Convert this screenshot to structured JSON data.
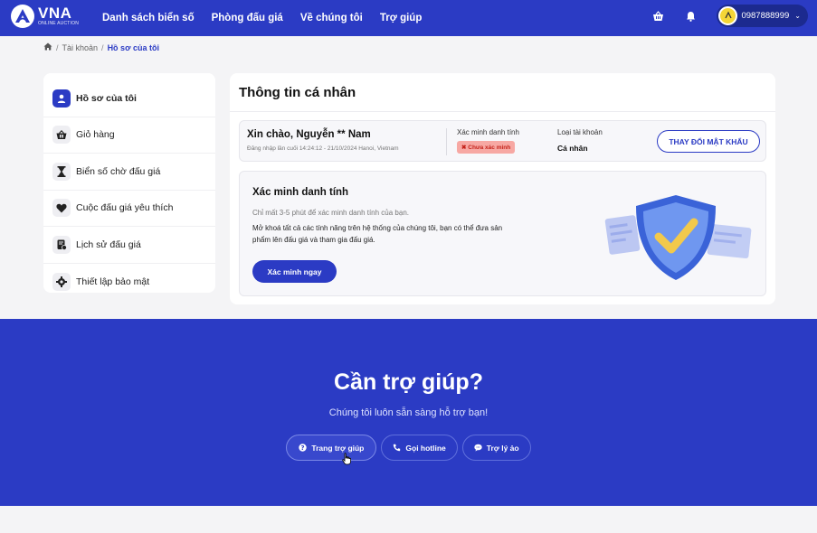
{
  "brand": {
    "name": "VNA",
    "tagline": "ONLINE AUCTION"
  },
  "nav": {
    "items": [
      {
        "label": "Danh sách biển số"
      },
      {
        "label": "Phòng đấu giá"
      },
      {
        "label": "Về chúng tôi"
      },
      {
        "label": "Trợ giúp"
      }
    ]
  },
  "user": {
    "phone": "0987888999"
  },
  "breadcrumb": {
    "items": [
      "Tài khoản"
    ],
    "current": "Hồ sơ của tôi"
  },
  "sidebar": {
    "items": [
      {
        "label": "Hồ sơ của tôi",
        "icon": "user-icon",
        "active": true
      },
      {
        "label": "Giỏ hàng",
        "icon": "basket-icon"
      },
      {
        "label": "Biển số chờ đấu giá",
        "icon": "hourglass-icon"
      },
      {
        "label": "Cuộc đấu giá yêu thích",
        "icon": "heart-icon"
      },
      {
        "label": "Lịch sử đấu giá",
        "icon": "history-icon"
      },
      {
        "label": "Thiết lập bảo mật",
        "icon": "gear-icon"
      }
    ]
  },
  "profile": {
    "title": "Thông tin cá nhân",
    "greeting": "Xin chào, Nguyễn ** Nam",
    "last_login": "Đăng nhập lần cuối 14:24:12 - 21/10/2024 Hanoi, Vietnam",
    "verify_label": "Xác minh danh tính",
    "verify_status": "✖ Chưa xác minh",
    "account_type_label": "Loại tài khoản",
    "account_type": "Cá nhân",
    "change_password": "THAY ĐỔI MẬT KHẨU"
  },
  "verify_card": {
    "title": "Xác minh danh tính",
    "subtitle": "Chỉ mất 3-5 phút để xác minh danh tính của bạn.",
    "description": "Mở khoá tất cả các tính năng trên hệ thống của chúng tôi, bạn có thể đưa sản phẩm lên đấu giá và tham gia đấu giá.",
    "button": "Xác minh ngay"
  },
  "help": {
    "title": "Cần trợ giúp?",
    "subtitle": "Chúng tôi luôn sẵn sàng hỗ trợ bạn!",
    "buttons": [
      {
        "label": "Trang trợ giúp",
        "icon": "question-icon"
      },
      {
        "label": "Gọi hotline",
        "icon": "phone-icon"
      },
      {
        "label": "Trợ lý ảo",
        "icon": "chat-icon"
      }
    ]
  },
  "colors": {
    "primary": "#2b3bc4",
    "danger_bg": "#f7a8a3",
    "danger_text": "#c4221a"
  }
}
